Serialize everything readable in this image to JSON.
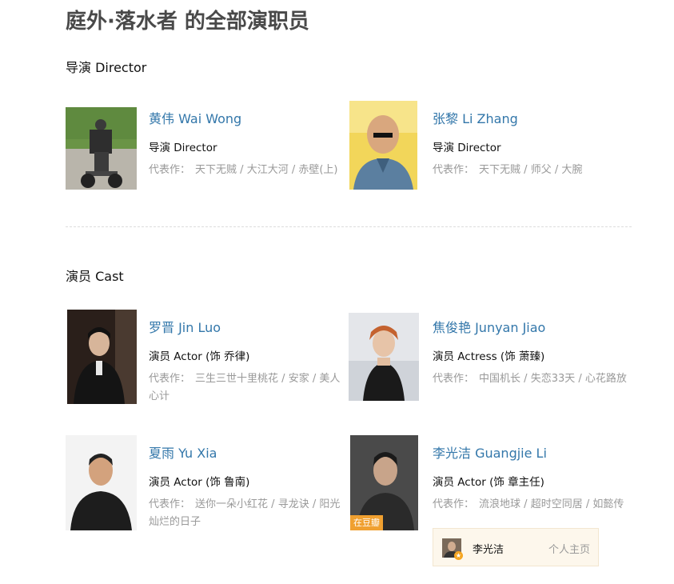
{
  "page_title": "庭外·落水者 的全部演职员",
  "sections": {
    "directors_title": "导演 Director",
    "cast_title": "演员 Cast"
  },
  "works_label": "代表作：",
  "directors": [
    {
      "name": "黄伟 Wai Wong",
      "role": "导演 Director",
      "works": [
        "天下无贼",
        "大江大河",
        "赤壁(上)"
      ]
    },
    {
      "name": "张黎 Li Zhang",
      "role": "导演 Director",
      "works": [
        "天下无贼",
        "师父",
        "大腕"
      ]
    }
  ],
  "cast": [
    {
      "name": "罗晋 Jin Luo",
      "role": "演员 Actor (饰 乔律)",
      "works": [
        "三生三世十里桃花",
        "安家",
        "美人心计"
      ]
    },
    {
      "name": "焦俊艳 Junyan Jiao",
      "role": "演员 Actress (饰 萧臻)",
      "works": [
        "中国机长",
        "失恋33天",
        "心花路放"
      ]
    },
    {
      "name": "夏雨 Yu Xia",
      "role": "演员 Actor (饰 鲁南)",
      "works": [
        "送你一朵小红花",
        "寻龙诀",
        "阳光灿烂的日子"
      ]
    },
    {
      "name": "李光洁 Guangjie Li",
      "role": "演员 Actor (饰 章主任)",
      "works": [
        "流浪地球",
        "超时空同居",
        "如懿传"
      ],
      "badge": "在豆瓣"
    }
  ],
  "hover_card": {
    "name": "李光洁",
    "link": "个人主页"
  },
  "colors": {
    "link": "#3377aa",
    "muted": "#999999",
    "title": "#494949",
    "badge": "#f0a030",
    "hover_bg": "#fdf7ec"
  }
}
